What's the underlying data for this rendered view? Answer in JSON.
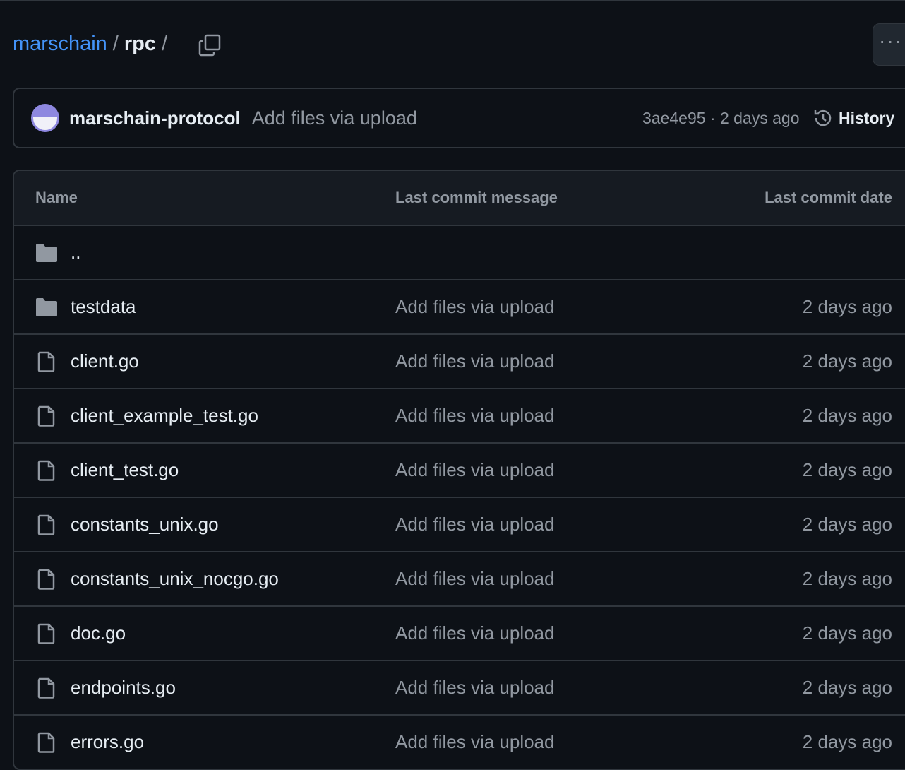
{
  "breadcrumb": {
    "owner": "marschain",
    "dir": "rpc",
    "sep": "/"
  },
  "more_label": "···",
  "commit": {
    "author": "marschain-protocol",
    "message": "Add files via upload",
    "sha_date": "3ae4e95 · 2 days ago",
    "history_label": "History"
  },
  "table": {
    "headers": {
      "name": "Name",
      "message": "Last commit message",
      "date": "Last commit date"
    },
    "parent": "..",
    "rows": [
      {
        "name": "testdata",
        "type": "folder",
        "message": "Add files via upload",
        "date": "2 days ago"
      },
      {
        "name": "client.go",
        "type": "file",
        "message": "Add files via upload",
        "date": "2 days ago"
      },
      {
        "name": "client_example_test.go",
        "type": "file",
        "message": "Add files via upload",
        "date": "2 days ago"
      },
      {
        "name": "client_test.go",
        "type": "file",
        "message": "Add files via upload",
        "date": "2 days ago"
      },
      {
        "name": "constants_unix.go",
        "type": "file",
        "message": "Add files via upload",
        "date": "2 days ago"
      },
      {
        "name": "constants_unix_nocgo.go",
        "type": "file",
        "message": "Add files via upload",
        "date": "2 days ago"
      },
      {
        "name": "doc.go",
        "type": "file",
        "message": "Add files via upload",
        "date": "2 days ago"
      },
      {
        "name": "endpoints.go",
        "type": "file",
        "message": "Add files via upload",
        "date": "2 days ago"
      },
      {
        "name": "errors.go",
        "type": "file",
        "message": "Add files via upload",
        "date": "2 days ago"
      }
    ]
  }
}
